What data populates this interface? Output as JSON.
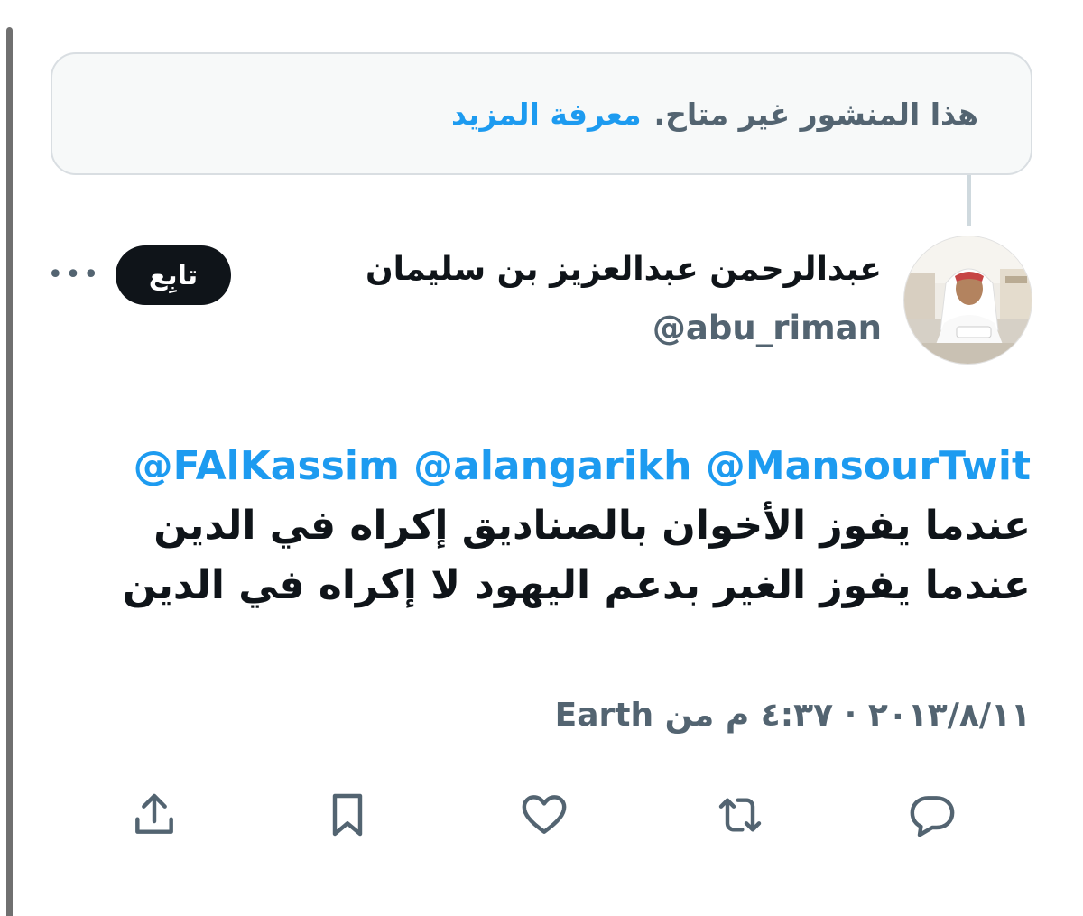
{
  "notice": {
    "message": "هذا المنشور غير متاح.",
    "learn_more": "معرفة المزيد"
  },
  "author": {
    "name": "عبدالرحمن عبدالعزيز بن سليمان",
    "handle": "@abu_riman"
  },
  "follow_label": "تابِع",
  "more_label": "•••",
  "tweet": {
    "mentions": [
      "@FAlKassim",
      "@alangarikh",
      "@MansourTwit"
    ],
    "lines": [
      "عندما يفوز الأخوان بالصناديق إكراه في الدين",
      "عندما يفوز الغير بدعم اليهود لا إكراه في الدين"
    ]
  },
  "meta_text": "٤:٣٧ م من Earth",
  "meta_date": "٢٠١٣/٨/١١",
  "meta_sep": "·",
  "actions": [
    "share-icon",
    "bookmark-icon",
    "like-icon",
    "retweet-icon",
    "reply-icon"
  ],
  "colors": {
    "accent": "#1d9bf0",
    "text": "#0f1419",
    "secondary": "#536471",
    "border": "#d9dee2"
  }
}
